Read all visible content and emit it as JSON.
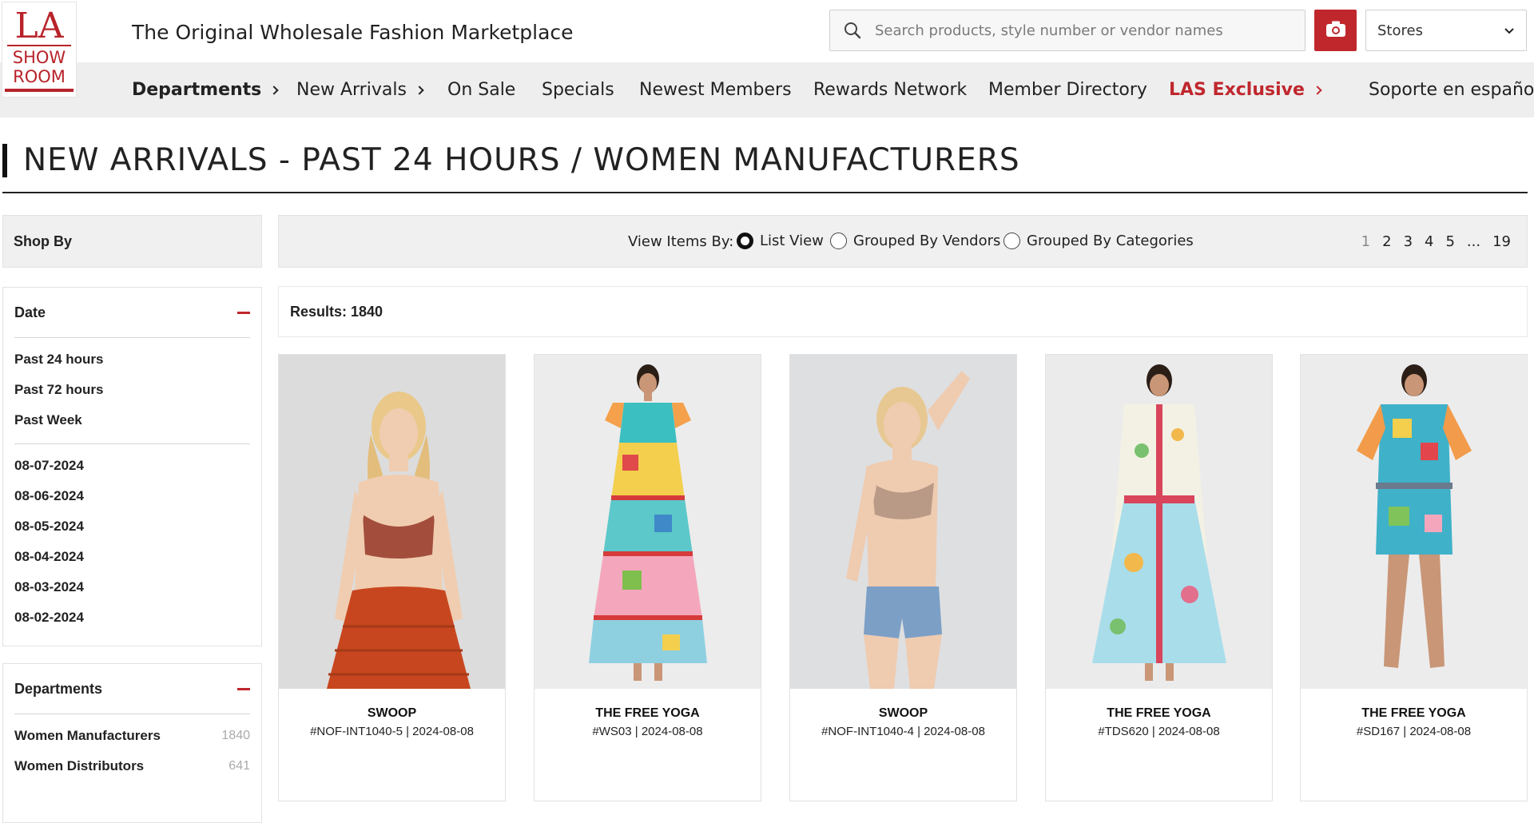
{
  "header": {
    "logo_lines": [
      "LA",
      "SHOW",
      "ROOM"
    ],
    "tagline": "The Original Wholesale Fashion Marketplace",
    "search_placeholder": "Search products, style number or vendor names",
    "stores_label": "Stores",
    "accent_color": "#c0272d"
  },
  "nav": {
    "items": [
      {
        "label": "Departments"
      },
      {
        "label": "New Arrivals"
      },
      {
        "label": "On Sale"
      },
      {
        "label": "Specials"
      },
      {
        "label": "Newest Members"
      },
      {
        "label": "Rewards Network"
      },
      {
        "label": "Member Directory"
      },
      {
        "label": "LAS Exclusive"
      },
      {
        "label": "Soporte en español"
      }
    ]
  },
  "page": {
    "title": "NEW ARRIVALS - PAST 24 HOURS / WOMEN MANUFACTURERS"
  },
  "sidebar": {
    "shop_by": "Shop By",
    "date": {
      "heading": "Date",
      "ranges": [
        "Past 24 hours",
        "Past 72 hours",
        "Past Week"
      ],
      "days": [
        "08-07-2024",
        "08-06-2024",
        "08-05-2024",
        "08-04-2024",
        "08-03-2024",
        "08-02-2024"
      ]
    },
    "departments": {
      "heading": "Departments",
      "items": [
        {
          "label": "Women Manufacturers",
          "count": "1840"
        },
        {
          "label": "Women Distributors",
          "count": "641"
        }
      ]
    }
  },
  "toolbar": {
    "view_label": "View Items By:",
    "options": [
      "List View",
      "Grouped By Vendors",
      "Grouped By Categories"
    ],
    "selected": "List View",
    "pages": [
      "1",
      "2",
      "3",
      "4",
      "5",
      "...",
      "19"
    ],
    "current_page": "1"
  },
  "results": {
    "label": "Results: 1840"
  },
  "products": [
    {
      "vendor": "SWOOP",
      "style": "#NOF-INT1040-5 | 2024-08-08"
    },
    {
      "vendor": "THE FREE YOGA",
      "style": "#WS03 | 2024-08-08"
    },
    {
      "vendor": "SWOOP",
      "style": "#NOF-INT1040-4 | 2024-08-08"
    },
    {
      "vendor": "THE FREE YOGA",
      "style": "#TDS620 | 2024-08-08"
    },
    {
      "vendor": "THE FREE YOGA",
      "style": "#SD167 | 2024-08-08"
    }
  ]
}
